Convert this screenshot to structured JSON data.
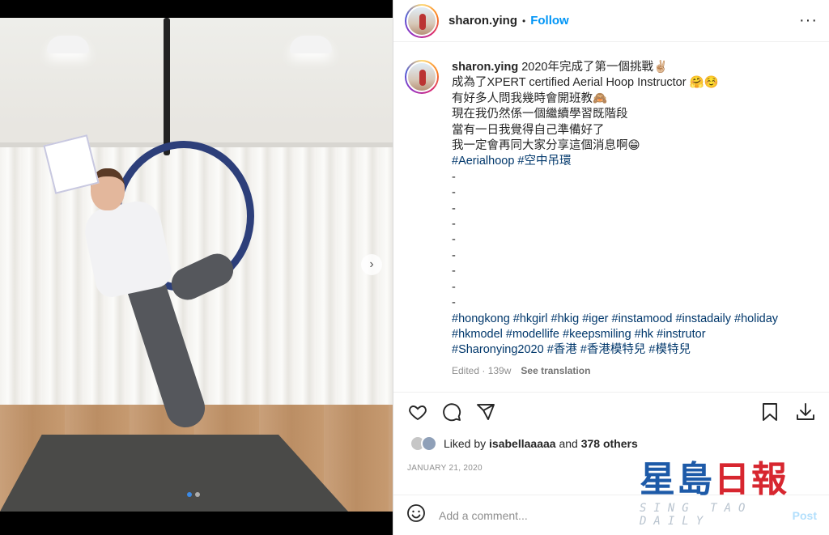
{
  "post": {
    "username": "sharon.ying",
    "separator": "•",
    "follow_label": "Follow",
    "more_label": "···"
  },
  "caption": {
    "username": "sharon.ying",
    "lines": [
      "2020年完成了第一個挑戰✌🏼",
      "成為了XPERT certified Aerial Hoop Instructor 🤗☺️",
      "有好多人問我幾時會開班教🙈",
      "現在我仍然係一個繼續學習既階段",
      "當有一日我覺得自己準備好了",
      "我一定會再同大家分享這個消息啊😁"
    ],
    "hashtags_line1": "#Aerialhoop #空中吊環",
    "dashes": [
      "-",
      "-",
      "-",
      "-",
      "-",
      "-",
      "-",
      "-",
      "-"
    ],
    "hashtags_block": [
      "#hongkong #hkgirl #hkig #iger #instamood #instadaily #holiday",
      "#hkmodel #modellife #keepsmiling #hk #instrutor",
      "#Sharonying2020 #香港 #香港模特兒 #模特兒"
    ],
    "edited": "Edited · 139w",
    "see_translation": "See translation"
  },
  "likes": {
    "prefix": "Liked by",
    "user": "isabellaaaaa",
    "middle": "and",
    "others": "378 others"
  },
  "date": "JANUARY 21, 2020",
  "comment": {
    "placeholder": "Add a comment...",
    "post_label": "Post"
  },
  "watermark": {
    "chars": [
      "星島",
      "日報"
    ],
    "subtitle": "SING TAO DAILY"
  },
  "colors": {
    "link_blue": "#0095f6",
    "hashtag": "#00376b",
    "wm_blue": "#1d5aa8",
    "wm_red": "#d7262f"
  },
  "icons": [
    "more-options-icon",
    "heart-icon",
    "comment-icon",
    "share-icon",
    "save-icon",
    "download-icon",
    "emoji-icon",
    "next-photo-icon"
  ],
  "carousel": {
    "total": 2,
    "active": 1
  }
}
